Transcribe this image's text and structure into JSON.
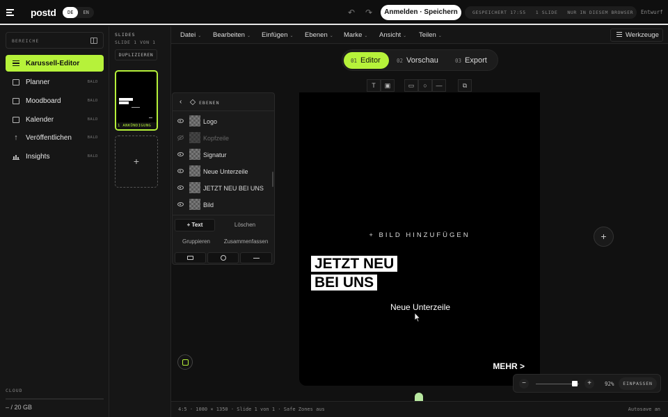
{
  "app": {
    "logo": "postd",
    "languages": [
      "DE",
      "EN"
    ],
    "active_language": "DE",
    "login_button": "Anmelden · Speichern",
    "status": {
      "saved": "GESPEICHERT 17:55",
      "slides": "1 SLIDE",
      "storage_note": "NUR IN DIESEM BROWSER"
    },
    "draft_label": "Entwurf",
    "accent_color": "#b6f23a"
  },
  "sidebar": {
    "section_label": "BEREICHE",
    "items": [
      {
        "label": "Karussell-Editor",
        "badge": "",
        "active": true,
        "icon": "lines-icon"
      },
      {
        "label": "Planner",
        "badge": "BALD",
        "active": false,
        "icon": "table-icon"
      },
      {
        "label": "Moodboard",
        "badge": "BALD",
        "active": false,
        "icon": "grid-icon"
      },
      {
        "label": "Kalender",
        "badge": "BALD",
        "active": false,
        "icon": "calendar-icon"
      },
      {
        "label": "Veröffentlichen",
        "badge": "BALD",
        "active": false,
        "icon": "arrow-up-icon"
      },
      {
        "label": "Insights",
        "badge": "BALD",
        "active": false,
        "icon": "bar-chart-icon"
      }
    ],
    "cloud_label": "CLOUD",
    "storage_text": "– / 20 GB"
  },
  "slides_panel": {
    "title": "SLIDES",
    "subtitle": "SLIDE 1 VON 1",
    "duplicate_button": "DUPLIZIEREN",
    "thumb_caption": "1  ANKÜNDIGUNG",
    "add_slide": "+"
  },
  "menu": {
    "items": [
      "Datei",
      "Bearbeiten",
      "Einfügen",
      "Ebenen",
      "Marke",
      "Ansicht",
      "Teilen"
    ],
    "tools_button": "Werkzeuge"
  },
  "modes": [
    {
      "num": "01",
      "label": "Editor",
      "active": true
    },
    {
      "num": "02",
      "label": "Vorschau",
      "active": false
    },
    {
      "num": "03",
      "label": "Export",
      "active": false
    }
  ],
  "insert_tools": [
    "text-tool-icon",
    "image-tool-icon",
    "rectangle-tool-icon",
    "circle-tool-icon",
    "line-tool-icon",
    "copy-tool-icon"
  ],
  "canvas": {
    "add_image": "+ BILD HINZUFÜGEN",
    "headline_line1": "JETZT NEU",
    "headline_line2": "BEI UNS",
    "subline": "Neue Unterzeile",
    "more": "MEHR >"
  },
  "layers_panel": {
    "title": "EBENEN",
    "layers": [
      {
        "name": "Logo",
        "visible": true
      },
      {
        "name": "Kopfzeile",
        "visible": false
      },
      {
        "name": "Signatur",
        "visible": true
      },
      {
        "name": "Neue Unterzeile",
        "visible": true
      },
      {
        "name": "JETZT NEU BEI UNS",
        "visible": true
      },
      {
        "name": "Bild",
        "visible": true
      }
    ],
    "add_text": "+ Text",
    "delete": "Löschen",
    "group": "Gruppieren",
    "merge": "Zusammenfassen"
  },
  "zoom": {
    "minus": "−",
    "plus": "+",
    "value": "92%",
    "level": 0.92,
    "fit_button": "EINPASSEN"
  },
  "statusbar": {
    "left": "4:5 · 1080 × 1350 · Slide 1 von 1 · Safe Zones aus",
    "right": "Autosave an"
  }
}
